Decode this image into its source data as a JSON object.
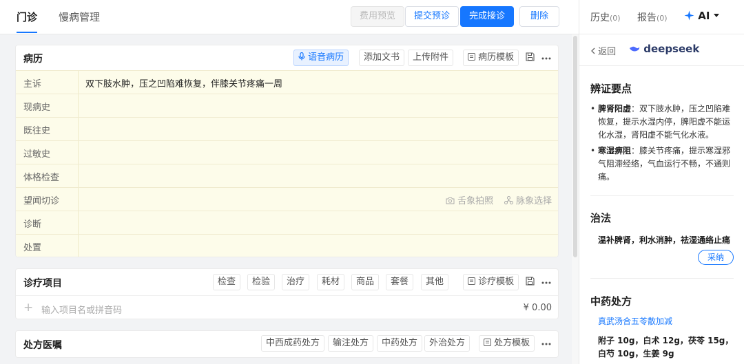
{
  "header": {
    "tabs": [
      {
        "label": "门诊"
      },
      {
        "label": "慢病管理"
      }
    ],
    "buttons": {
      "fee_preview": "费用预览",
      "submit_check": "提交预诊",
      "complete": "完成接诊",
      "delete": "删除"
    }
  },
  "record": {
    "title": "病历",
    "tools": {
      "voice": "语音病历",
      "add_doc": "添加文书",
      "upload": "上传附件",
      "template": "病历模板"
    },
    "rows": [
      {
        "label": "主诉",
        "value": "双下肢水肿，压之凹陷难恢复，伴膝关节疼痛一周"
      },
      {
        "label": "现病史",
        "value": ""
      },
      {
        "label": "既往史",
        "value": ""
      },
      {
        "label": "过敏史",
        "value": ""
      },
      {
        "label": "体格检查",
        "value": ""
      },
      {
        "label": "望闻切诊",
        "value": ""
      },
      {
        "label": "诊断",
        "value": ""
      },
      {
        "label": "处置",
        "value": ""
      }
    ],
    "tongue_photo": "舌象拍照",
    "pulse_select": "脉象选择"
  },
  "treatment": {
    "title": "诊疗项目",
    "chips": [
      "检查",
      "检验",
      "治疗",
      "耗材",
      "商品",
      "套餐",
      "其他"
    ],
    "template": "诊疗模板",
    "placeholder": "输入项目名或拼音码",
    "amount": "¥ 0.00"
  },
  "prescription": {
    "title": "处方医嘱",
    "chips": [
      "中西成药处方",
      "输注处方",
      "中药处方",
      "外治处方"
    ],
    "template": "处方模板"
  },
  "right_panel": {
    "tabs": [
      {
        "label": "历史",
        "count": "(0)"
      },
      {
        "label": "报告",
        "count": "(0)"
      }
    ],
    "ai_label": "AI",
    "back_label": "返回",
    "brand": "deepseek",
    "sections": {
      "syndrome_title": "辨证要点",
      "bullets": [
        {
          "term": "脾肾阳虚",
          "text": "：双下肢水肿，压之凹陷难恢复，提示水湿内停，脾阳虚不能运化水湿，肾阳虚不能气化水液。"
        },
        {
          "term": "寒湿痹阻",
          "text": "：膝关节疼痛，提示寒湿邪气阻滞经络，气血运行不畅，不通则痛。"
        }
      ],
      "treatment_title": "治法",
      "treatment_text": "温补脾肾，利水消肿，祛湿通络止痛",
      "adopt": "采纳",
      "herbal_title": "中药处方",
      "formula_name": "真武汤合五苓散加减",
      "formula_body": "附子 10g，白术 12g，茯苓 15g，白芍 10g，生姜 9g"
    }
  },
  "colors": {
    "accent": "#1677ff",
    "record_bg": "#fdfcea"
  }
}
